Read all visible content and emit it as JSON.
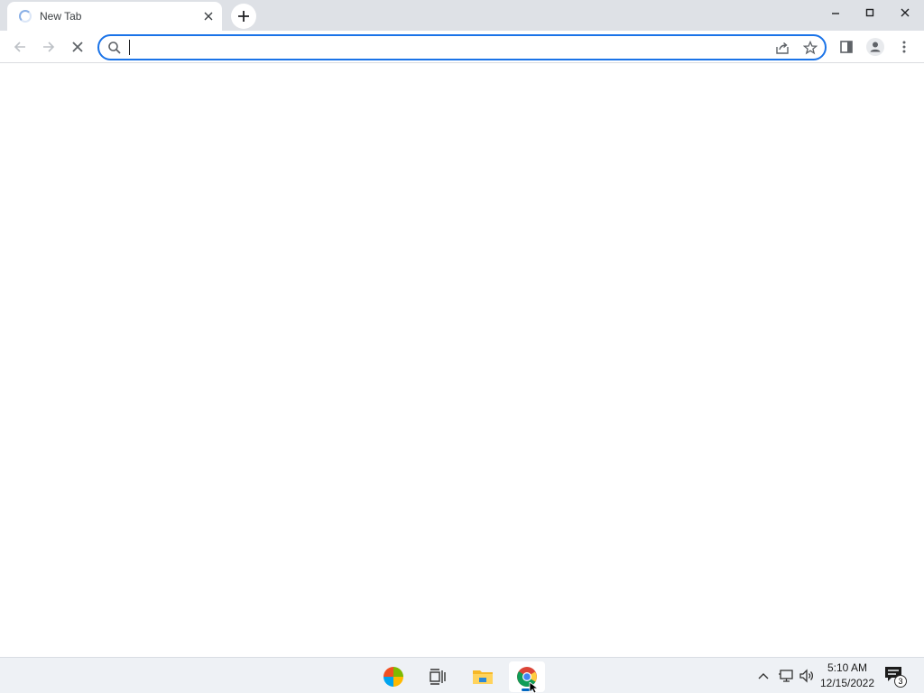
{
  "browser": {
    "tab": {
      "title": "New Tab",
      "loading": true
    },
    "address_bar": {
      "value": "",
      "placeholder": ""
    },
    "icons": {
      "back": "arrow-left-icon",
      "forward": "arrow-right-icon",
      "stop": "close-icon",
      "search": "search-icon",
      "share": "share-icon",
      "bookmark": "star-icon",
      "side_panel": "side-panel-icon",
      "profile": "profile-icon",
      "menu": "more-vertical-icon"
    },
    "colors": {
      "accent": "#1a73e8",
      "tabstrip": "#dee1e6"
    }
  },
  "taskbar": {
    "apps": [
      {
        "name": "Start",
        "icon": "windows-logo-icon"
      },
      {
        "name": "Task View",
        "icon": "task-view-icon"
      },
      {
        "name": "File Explorer",
        "icon": "folder-icon"
      },
      {
        "name": "Google Chrome",
        "icon": "chrome-icon",
        "active": true
      }
    ],
    "tray": {
      "time": "5:10 AM",
      "date": "12/15/2022",
      "notification_count": "3"
    }
  }
}
